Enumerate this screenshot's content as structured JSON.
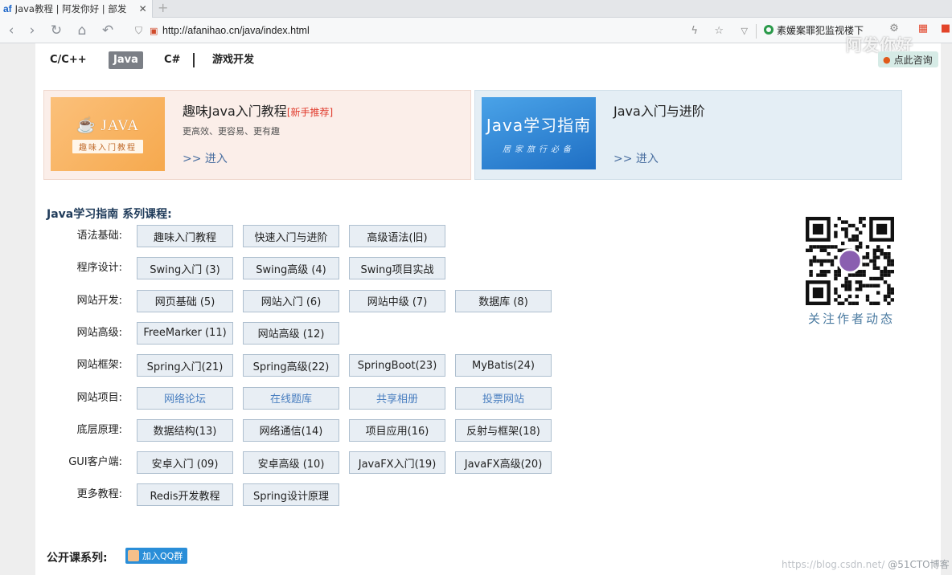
{
  "browser": {
    "tab_title": "Java教程 | 阿发你好 | 部发",
    "favicon": "af",
    "url": "http://afanihao.cn/java/index.html",
    "search_text": "素媛案罪犯监视楼下"
  },
  "topnav": {
    "items": [
      "C/C++",
      "Java",
      "C#",
      "游戏开发"
    ],
    "active": "Java",
    "watermark": "阿发你好",
    "consult": "点此咨询"
  },
  "banners": [
    {
      "thumb_logo": "☕ JAVA",
      "thumb_tag": "趣味入门教程",
      "title": "趣味Java入门教程",
      "hot": "[新手推荐]",
      "subtitle": "更高效、更容易、更有趣",
      "link": ">> 进入"
    },
    {
      "thumb_logo": "Java学习指南",
      "thumb_tag": "居家旅行必备",
      "title": "Java入门与进阶",
      "link": ">> 进入"
    }
  ],
  "courses": {
    "title": "Java学习指南 系列课程:",
    "qr_caption": "关注作者动态",
    "rows": [
      {
        "label": "语法基础:",
        "items": [
          "趣味入门教程",
          "快速入门与进阶",
          "高级语法(旧)"
        ]
      },
      {
        "label": "程序设计:",
        "items": [
          "Swing入门 (3)",
          "Swing高级 (4)",
          "Swing项目实战"
        ]
      },
      {
        "label": "网站开发:",
        "items": [
          "网页基础 (5)",
          "网站入门 (6)",
          "网站中级 (7)",
          "数据库 (8)"
        ]
      },
      {
        "label": "网站高级:",
        "items": [
          "FreeMarker (11)",
          "网站高级 (12)"
        ]
      },
      {
        "label": "网站框架:",
        "items": [
          "Spring入门(21)",
          "Spring高级(22)",
          "SpringBoot(23)",
          "MyBatis(24)"
        ]
      },
      {
        "label": "网站项目:",
        "items": [
          "网络论坛",
          "在线题库",
          "共享相册",
          "投票网站"
        ]
      },
      {
        "label": "底层原理:",
        "items": [
          "数据结构(13)",
          "网络通信(14)",
          "项目应用(16)",
          "反射与框架(18)"
        ]
      },
      {
        "label": "GUI客户端:",
        "items": [
          "安卓入门 (09)",
          "安卓高级 (10)",
          "JavaFX入门(19)",
          "JavaFX高级(20)"
        ]
      },
      {
        "label": "更多教程:",
        "items": [
          "Redis开发教程",
          "Spring设计原理"
        ]
      }
    ]
  },
  "public": {
    "label": "公开课系列:",
    "qq_button": "加入QQ群"
  },
  "credit": {
    "text": "https://blog.csdn.net/",
    "brand": "@51CTO博客"
  }
}
